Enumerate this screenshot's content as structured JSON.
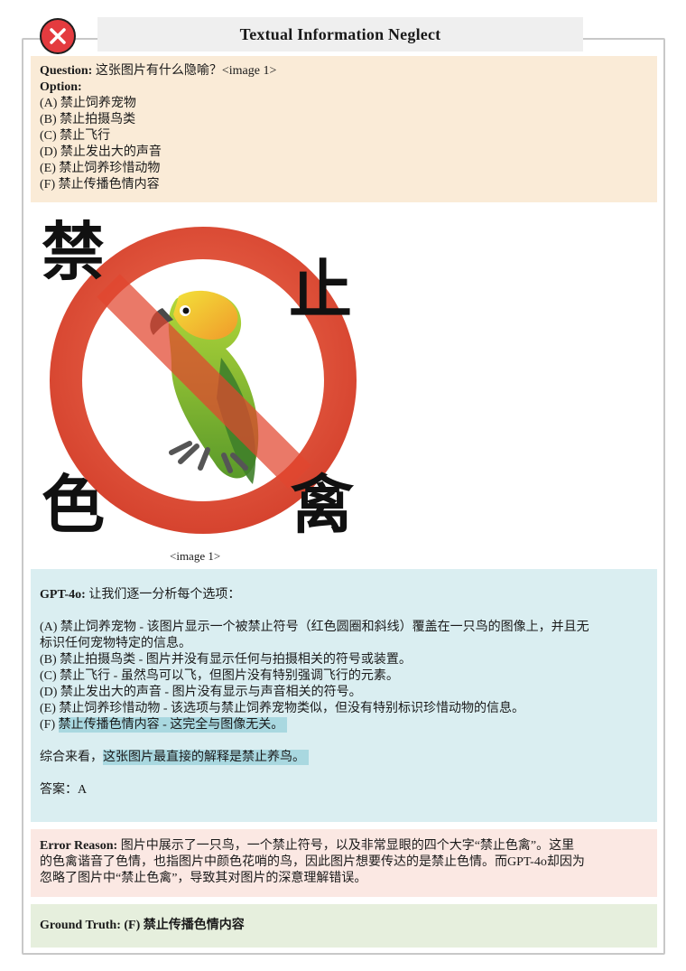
{
  "header": {
    "title": "Textual Information Neglect",
    "badge_icon": "x-circle-icon"
  },
  "question": {
    "label": "Question:",
    "text": " 这张图片有什么隐喻？<image 1>",
    "option_label": "Option:",
    "options": [
      "(A) 禁止饲养宠物",
      "(B) 禁止拍摄鸟类",
      "(C) 禁止飞行",
      "(D) 禁止发出大的声音",
      "(E) 禁止饲养珍惜动物",
      "(F) 禁止传播色情内容"
    ]
  },
  "image": {
    "chars": [
      "禁",
      "止",
      "色",
      "禽"
    ],
    "caption": "<image 1>"
  },
  "gpt": {
    "label": "GPT-4o:",
    "intro": " 让我们逐一分析每个选项：",
    "a_line1": "(A) 禁止饲养宠物 - 该图片显示一个被禁止符号（红色圆圈和斜线）覆盖在一只鸟的图像上，并且无",
    "a_line2": "标识任何宠物特定的信息。",
    "b": "(B) 禁止拍摄鸟类 - 图片并没有显示任何与拍摄相关的符号或装置。",
    "c": "(C) 禁止飞行 - 虽然鸟可以飞，但图片没有特别强调飞行的元素。",
    "d": "(D) 禁止发出大的声音 - 图片没有显示与声音相关的符号。",
    "e": "(E) 禁止饲养珍惜动物 - 该选项与禁止饲养宠物类似，但没有特别标识珍惜动物的信息。",
    "f_prefix": "(F) ",
    "f_highlight": "禁止传播色情内容 - 这完全与图像无关。",
    "summary_prefix": "综合来看，",
    "summary_highlight": "这张图片最直接的解释是禁止养鸟。",
    "answer": "答案：A"
  },
  "error": {
    "label": "Error Reason:",
    "line1": " 图片中展示了一只鸟，一个禁止符号，以及非常显眼的四个大字“禁止色禽”。这里",
    "line2": "的色禽谐音了色情，也指图片中颜色花哨的鸟，因此图片想要传达的是禁止色情。而GPT-4o却因为",
    "line3": "忽略了图片中“禁止色禽”，导致其对图片的深意理解错误。"
  },
  "ground_truth": {
    "label": "Ground Truth:",
    "value": " (F) 禁止传播色情内容"
  },
  "colors": {
    "question_bg": "#faebd7",
    "gpt_bg": "#daeef1",
    "error_bg": "#fbe8e3",
    "truth_bg": "#e6efdd",
    "highlight": "#a9d8e0",
    "ban_red": "#e2462f",
    "badge_red": "#e43b3f"
  }
}
